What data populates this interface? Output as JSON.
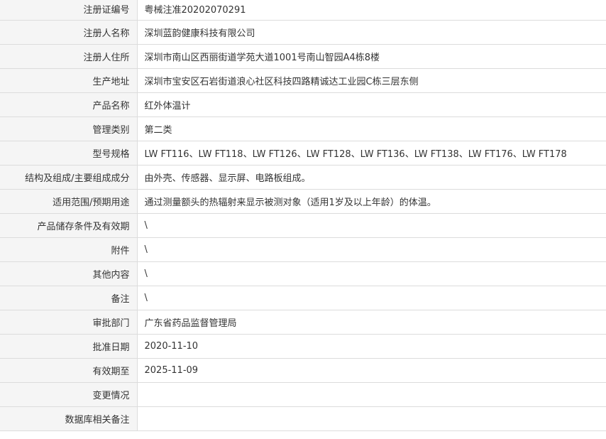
{
  "record": {
    "rows": [
      {
        "label": "注册证编号",
        "value": "粤械注准20202070291"
      },
      {
        "label": "注册人名称",
        "value": "深圳蓝韵健康科技有限公司"
      },
      {
        "label": "注册人住所",
        "value": "深圳市南山区西丽街道学苑大道1001号南山智园A4栋8楼"
      },
      {
        "label": "生产地址",
        "value": "深圳市宝安区石岩街道浪心社区科技四路精诚达工业园C栋三层东侧"
      },
      {
        "label": "产品名称",
        "value": "红外体温计"
      },
      {
        "label": "管理类别",
        "value": "第二类"
      },
      {
        "label": "型号规格",
        "value": "LW FT116、LW FT118、LW FT126、LW FT128、LW FT136、LW FT138、LW FT176、LW FT178"
      },
      {
        "label": "结构及组成/主要组成成分",
        "value": "由外壳、传感器、显示屏、电路板组成。"
      },
      {
        "label": "适用范围/预期用途",
        "value": "通过测量额头的热辐射来显示被测对象（适用1岁及以上年龄）的体温。"
      },
      {
        "label": "产品储存条件及有效期",
        "value": "\\"
      },
      {
        "label": "附件",
        "value": "\\"
      },
      {
        "label": "其他内容",
        "value": "\\"
      },
      {
        "label": "备注",
        "value": "\\"
      },
      {
        "label": "审批部门",
        "value": "广东省药品监督管理局"
      },
      {
        "label": "批准日期",
        "value": "2020-11-10"
      },
      {
        "label": "有效期至",
        "value": "2025-11-09"
      },
      {
        "label": "变更情况",
        "value": ""
      },
      {
        "label": "数据库相关备注",
        "value": ""
      }
    ]
  }
}
